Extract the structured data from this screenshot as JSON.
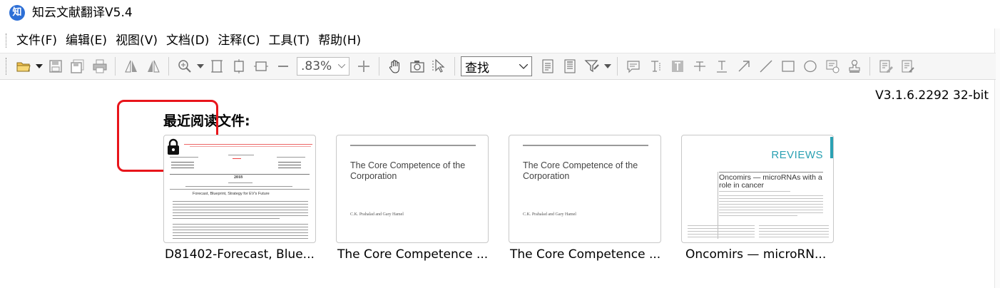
{
  "app": {
    "logo_text": "知",
    "title": "知云文献翻译V5.4",
    "version": "V3.1.6.2292 32-bit"
  },
  "menu": {
    "items": [
      "文件(F)",
      "编辑(E)",
      "视图(V)",
      "文档(D)",
      "注释(C)",
      "工具(T)",
      "帮助(H)"
    ]
  },
  "toolbar": {
    "zoom_value": ".83%",
    "find_label": "查找",
    "icons": [
      "open-folder-icon",
      "save-icon",
      "save-all-icon",
      "print-icon",
      "flip-horizontal-icon",
      "flip-vertical-icon",
      "zoom-in-icon",
      "fit-page-icon",
      "fit-width-icon",
      "fit-height-icon",
      "zoom-out-icon",
      "zoom-plus-icon",
      "hand-tool-icon",
      "snapshot-icon",
      "select-cursor-icon",
      "doc-list-icon",
      "doc-edit-icon",
      "filter-icon",
      "comment-icon",
      "text-cursor-icon",
      "highlight-text-icon",
      "strikethrough-icon",
      "underline-icon",
      "arrow-icon",
      "line-icon",
      "rectangle-icon",
      "ellipse-icon",
      "screen-icon",
      "stamp-icon",
      "edit-notes-icon",
      "edit-notes-2-icon"
    ]
  },
  "recent": {
    "heading": "最近阅读文件:",
    "documents": [
      {
        "name": "D81402-Forecast, Blue...",
        "locked": true,
        "thumb": {
          "year": "2018",
          "sub_title": "Forecast, Blueprint, Strategy for EV's Future"
        }
      },
      {
        "name": "The Core Competence ...",
        "locked": false,
        "thumb": {
          "title": "The Core Competence of the Corporation",
          "author": "C.K. Prahalad and Gary Hamel"
        }
      },
      {
        "name": "The Core Competence ...",
        "locked": false,
        "thumb": {
          "title": "The Core Competence of the Corporation",
          "author": "C.K. Prahalad and Gary Hamel"
        }
      },
      {
        "name": "Oncomirs — microRN...",
        "locked": false,
        "thumb": {
          "label": "REVIEWS",
          "title": "Oncomirs — microRNAs with a role in cancer"
        }
      }
    ]
  },
  "colors": {
    "logo": "#2d6fd6",
    "highlight_box": "#e8151b",
    "reviews_accent": "#2aa1b3"
  }
}
